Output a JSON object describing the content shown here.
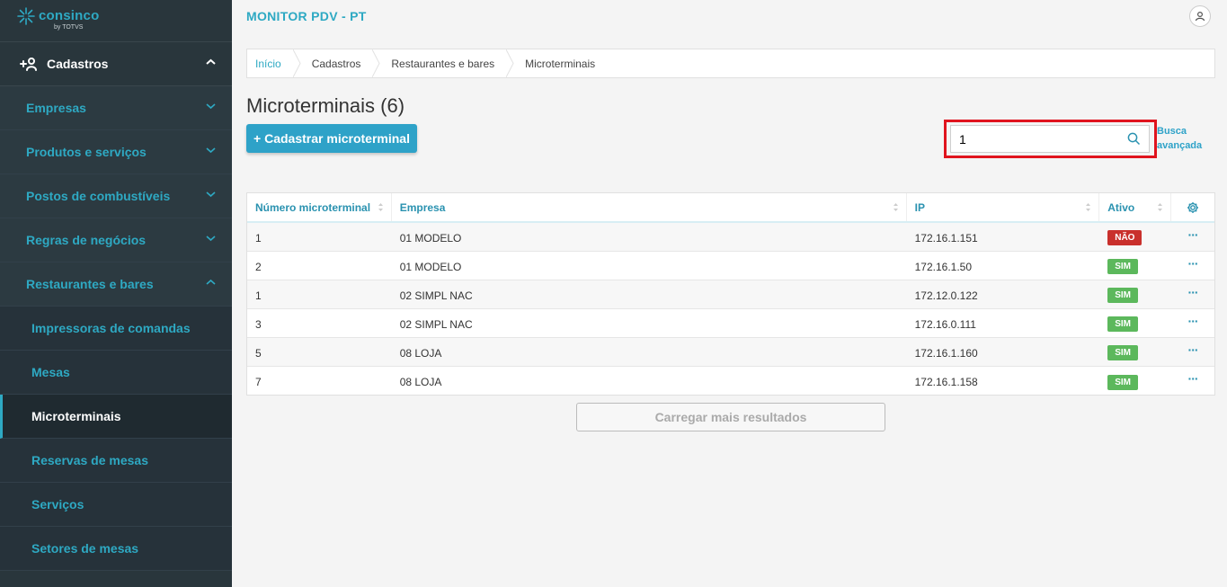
{
  "brand": {
    "name": "consinco",
    "sub": "by TOTVS"
  },
  "app_title": "MONITOR PDV - PT",
  "sidebar": {
    "group_label": "Cadastros",
    "items": [
      {
        "label": "Empresas"
      },
      {
        "label": "Produtos e serviços"
      },
      {
        "label": "Postos de combustíveis"
      },
      {
        "label": "Regras de negócios"
      },
      {
        "label": "Restaurantes e bares"
      }
    ],
    "subitems": [
      {
        "label": "Impressoras de comandas"
      },
      {
        "label": "Mesas"
      },
      {
        "label": "Microterminais"
      },
      {
        "label": "Reservas de mesas"
      },
      {
        "label": "Serviços"
      },
      {
        "label": "Setores de mesas"
      }
    ]
  },
  "breadcrumb": [
    "Início",
    "Cadastros",
    "Restaurantes e bares",
    "Microterminais"
  ],
  "page_title": "Microterminais (6)",
  "add_button": "+ Cadastrar microterminal",
  "search": {
    "value": "1"
  },
  "advanced_search": {
    "line1": "Busca",
    "line2": "avançada"
  },
  "table": {
    "headers": [
      "Número microterminal",
      "Empresa",
      "IP",
      "Ativo"
    ],
    "rows": [
      {
        "numero": "1",
        "empresa": "01 MODELO",
        "ip": "172.16.1.151",
        "ativo": "NÃO"
      },
      {
        "numero": "2",
        "empresa": "01 MODELO",
        "ip": "172.16.1.50",
        "ativo": "SIM"
      },
      {
        "numero": "1",
        "empresa": "02 SIMPL NAC",
        "ip": "172.12.0.122",
        "ativo": "SIM"
      },
      {
        "numero": "3",
        "empresa": "02 SIMPL NAC",
        "ip": "172.16.0.111",
        "ativo": "SIM"
      },
      {
        "numero": "5",
        "empresa": "08 LOJA",
        "ip": "172.16.1.160",
        "ativo": "SIM"
      },
      {
        "numero": "7",
        "empresa": "08 LOJA",
        "ip": "172.16.1.158",
        "ativo": "SIM"
      }
    ],
    "row_actions": "···"
  },
  "load_more": "Carregar mais resultados",
  "colors": {
    "accent": "#2ea9c3",
    "sidebar_bg": "#29363c",
    "danger": "#c9302c",
    "success": "#5cb85c",
    "highlight": "#e0141e"
  },
  "icons": [
    "logo-icon",
    "add-user-icon",
    "chevron-up-icon",
    "chevron-down-icon",
    "user-icon",
    "search-icon",
    "sort-icon",
    "gear-icon",
    "more-icon"
  ]
}
